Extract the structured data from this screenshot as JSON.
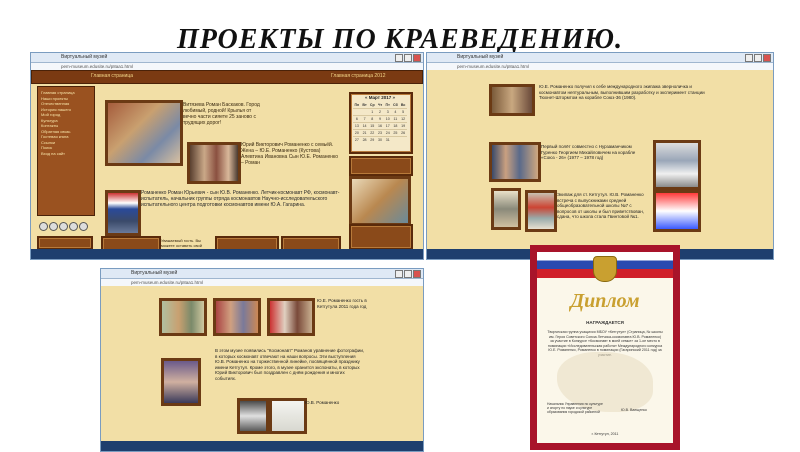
{
  "title": "ПРОЕКТЫ ПО КРАЕВЕДЕНИЮ.",
  "shot1": {
    "tab_text": "Виртуальный музей",
    "address": "pem-museum.edusite.ru/p8aa1.html",
    "header_left": "Главная страница",
    "header_right": "Главная страница 2012",
    "intro": "Витязева Роман Баскаков. Город любимый, родной! Крылья от вечно части сияете 25 заново с трудящих дорог!",
    "caption_family": "Юрий Викторович Романенко с семьёй. Жена – Ю.Е. Романенко (Кустова) Алевтина Ивановна Сын Ю.Е. Романенко – Роман",
    "caption_main": "Романенко Роман Юрьевич - сын Ю.В. Романенко. Летчик-космонавт РФ, космонавт-испытатель, начальник группы отряда космонавтов Научно-исследовательского испытательного центра подготовки космонавтов имени Ю.А. Гагарина.",
    "bottom_text": "Уважаемый гость. Вы можете оставить свой отзыв",
    "calendar_title": "« Март 2017 »",
    "calendar_week": [
      "Пн",
      "Вт",
      "Ср",
      "Чт",
      "Пт",
      "Сб",
      "Вс"
    ],
    "calendar_days": [
      "",
      "",
      "1",
      "2",
      "3",
      "4",
      "5",
      "6",
      "7",
      "8",
      "9",
      "10",
      "11",
      "12",
      "13",
      "14",
      "15",
      "16",
      "17",
      "18",
      "19",
      "20",
      "21",
      "22",
      "23",
      "24",
      "25",
      "26",
      "27",
      "28",
      "29",
      "30",
      "31",
      "",
      ""
    ],
    "menu": [
      "Главная страница",
      "Наши проекты",
      "Отечественная",
      "История нашего",
      "Мой город",
      "Культура",
      "Контакты",
      "Обратная связь",
      "Гостевая книга",
      "Ссылки",
      "Поиск",
      "Вход на сайт"
    ]
  },
  "shot2": {
    "tab_text": "Виртуальный музей",
    "address": "pem-museum.edusite.ru/p8aa1.html",
    "para1": "Ю.Е. Романенко получил к себе международного экипажа зверноличка и космонавтом нептуральным, выполнившим разработку и эксперимент станции Тюхнет-Штормтом на корабле Союз-36 (1980).",
    "para2": "Первый полёт совместно с Нурзаманчиком Гуренко Георгием Михайловичем на корабле «Союз - 26» (1977 – 1978 год)",
    "para3": "Экипаж для ст. Кетгутул. Ю.В. Романенко встреча с выпускниками средней общеобразовательной школы №7 с вопросов от школы и был приветствован, сдана, что школа стала Гвинтовой №1."
  },
  "shot3": {
    "tab_text": "Виртуальный музей",
    "address": "pem-museum.edusite.ru/p8aa1.html",
    "cap_top": "Ю.Е. Романенко гость в Кетгутула 2011 года год",
    "para": "В этом музее появились \"Космонавт\" Романов уравнение фотографии, в которых космонавт отвечают на наши вопросы. Эти выступления Ю.В. Романенко на торжественной линейке, посвящённой празднику имени Кетгутул. Кроме этого, в музее хранится экспонаты, в которых Юрий Викторович был поздравлен с днём рождения и многих событиях.",
    "cap_bottom": "Ю.В. Романенко"
  },
  "diploma": {
    "word": "Диплом",
    "award": "НАГРАЖДАЕТСЯ",
    "body": "Творческая группа учащихся МБОУ «Кетгутул» (Страница, № школы им. Героя Советского Союза Летчика-космонавта Ю.В. Романенко) за участие в Конкурсе «Космонавт в моей семье» за 1-ое место в номинации «Исследовательская работа» Международного конкурса Ю.Е. Романенко, Романенко в номинации (Гагаринский 2011 год) за участие.",
    "sign_label": "Начальник Управления по культуре и спорту по науке и культуре образования городской районной",
    "sign_name": "Ю.В. Ваещенко",
    "place": "г. Кетгутул, 2011"
  },
  "colors": {
    "page_bg": "#f2dfa6",
    "wood": "#8a4a1a",
    "diploma_border": "#a8142a",
    "title": "#111111"
  }
}
